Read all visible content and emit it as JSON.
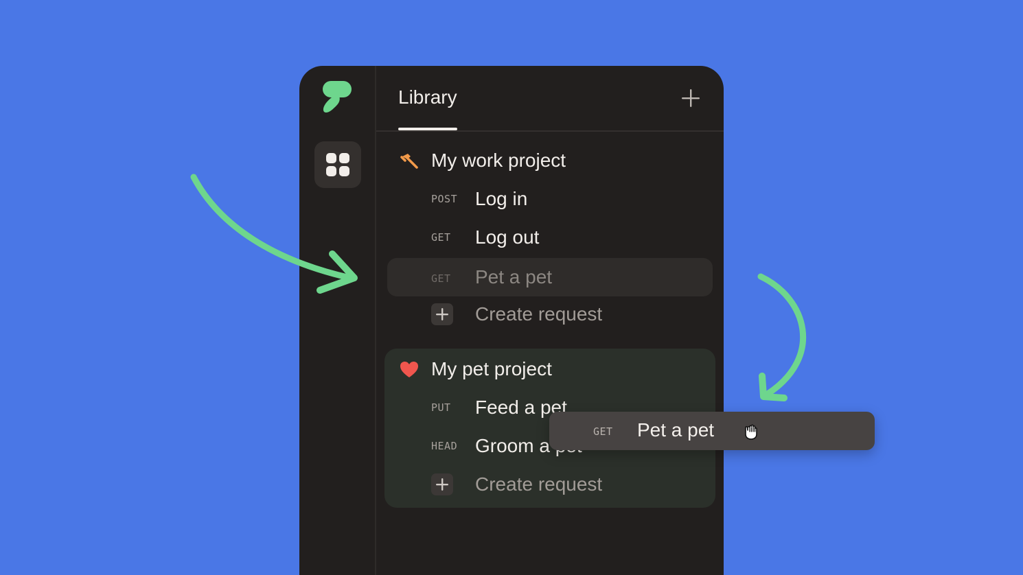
{
  "colors": {
    "background": "#4A77E6",
    "app": "#221F1E",
    "accent_green": "#6ED68D",
    "hammer": "#F29A4A",
    "heart": "#F0564E"
  },
  "sidebar": {
    "logo_icon": "logo-icon",
    "apps_icon": "grid-icon"
  },
  "header": {
    "tab_label": "Library",
    "add_icon": "plus-icon"
  },
  "projects": [
    {
      "title": "My work project",
      "icon": "hammer-icon",
      "requests": [
        {
          "method": "POST",
          "name": "Log in"
        },
        {
          "method": "GET",
          "name": "Log out"
        },
        {
          "method": "GET",
          "name": "Pet a pet"
        }
      ],
      "create_label": "Create request"
    },
    {
      "title": "My pet project",
      "icon": "heart-icon",
      "requests": [
        {
          "method": "PUT",
          "name": "Feed a pet"
        },
        {
          "method": "HEAD",
          "name": "Groom a pet"
        }
      ],
      "create_label": "Create request"
    }
  ],
  "drag_item": {
    "method": "GET",
    "name": "Pet a pet",
    "cursor_icon": "grab-hand-icon"
  }
}
